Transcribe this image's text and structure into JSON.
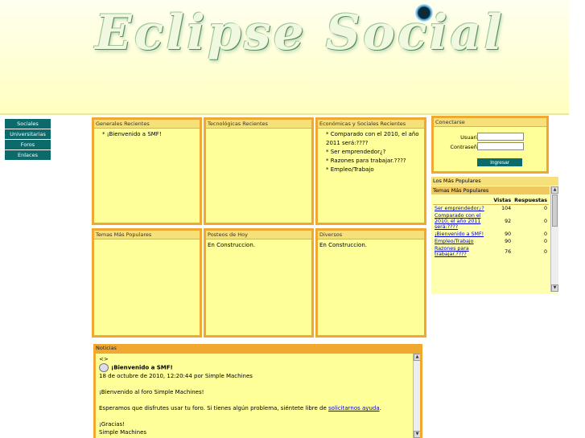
{
  "banner": {
    "title": "Eclipse Social"
  },
  "nav": {
    "items": [
      "Sociales",
      "Universitarias",
      "Foros",
      "Enlaces"
    ]
  },
  "panels": [
    {
      "title": "Generales Recientes",
      "items": [
        "* ¡Bienvenido a SMF!"
      ]
    },
    {
      "title": "Tecnológicas Recientes",
      "items": []
    },
    {
      "title": "Económicas y Sociales Recientes",
      "items": [
        "* Comparado con el 2010, el año 2011 será:????",
        "* Ser emprendedor¿?",
        "* Razones para trabajar.????",
        "* Empleo/Trabajo"
      ]
    },
    {
      "title": "Temas Más Populares",
      "items": []
    },
    {
      "title": "Posteos de Hoy",
      "items": [
        "En Construccion."
      ]
    },
    {
      "title": "Diversos",
      "items": [
        "En Construccion."
      ]
    }
  ],
  "login": {
    "title": "Conectarse",
    "user_label": "Usuario:",
    "pass_label": "Contraseña:",
    "button": "Ingresar"
  },
  "popular": {
    "title": "Los Más Populares",
    "subtitle": "Temas Más Populares",
    "col_views": "Vistas",
    "col_replies": "Respuestas",
    "rows": [
      {
        "topic": "Ser emprendedor¿?",
        "views": "104",
        "replies": "0"
      },
      {
        "topic": "Comparado con el 2010, el año 2011 será:????",
        "views": "92",
        "replies": "0"
      },
      {
        "topic": "¡Bienvenido a SMF!",
        "views": "90",
        "replies": "0"
      },
      {
        "topic": "Empleo/Trabajo",
        "views": "90",
        "replies": "0"
      },
      {
        "topic": "Razones para trabajar.????",
        "views": "76",
        "replies": "0"
      }
    ]
  },
  "news": {
    "title": "Noticias",
    "nav_arrows": "<>",
    "post_title": "¡Bienvenido a SMF!",
    "meta": "18 de octubre de 2010, 12:20:44 por Simple Machines",
    "p1": "¡Bienvenido al foro Simple Machines!",
    "p2_before": "Esperamos que disfrutes usar tu foro.  Si tienes algún problema, siéntete libre de ",
    "p2_link": "solicitarnos ayuda",
    "p2_after": ".",
    "p3": "¡Gracias!",
    "p4": "Simple Machines"
  }
}
